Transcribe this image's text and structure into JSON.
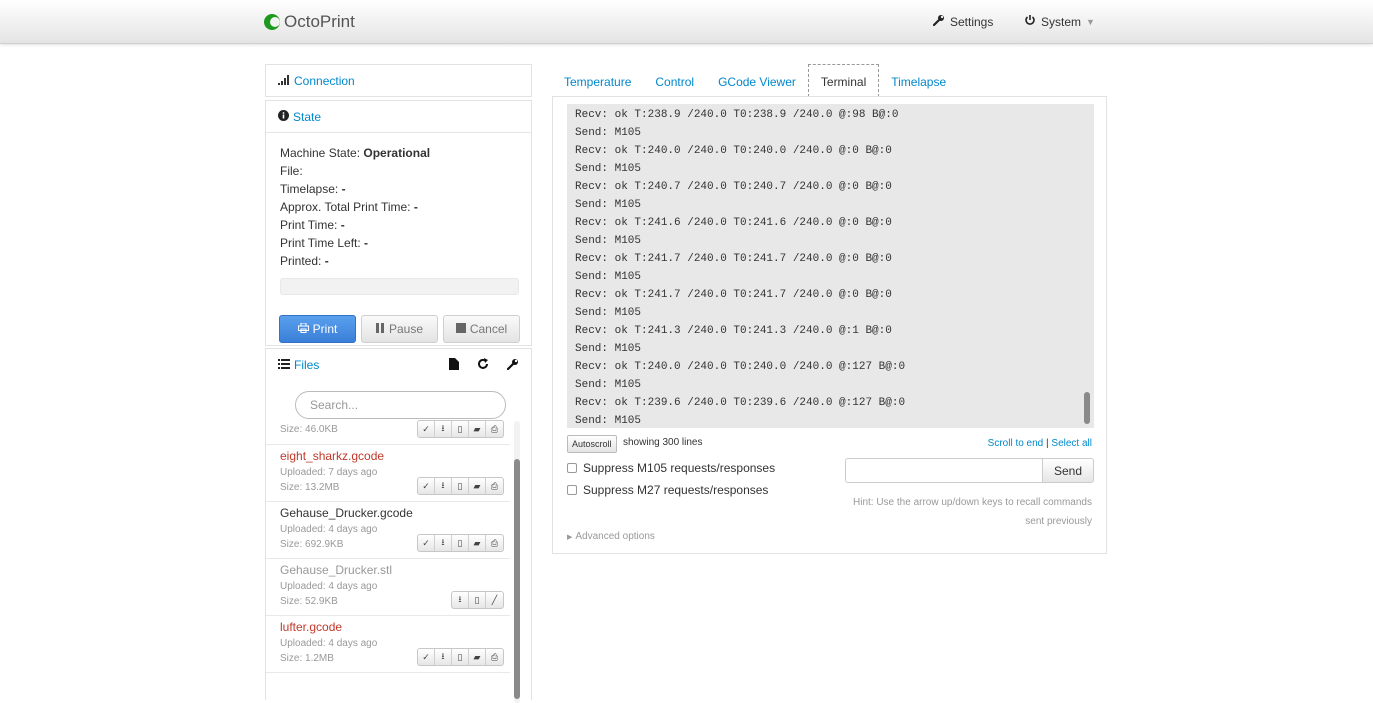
{
  "navbar": {
    "brand": "OctoPrint",
    "settings": "Settings",
    "system": "System"
  },
  "connection": {
    "title": "Connection"
  },
  "state": {
    "title": "State",
    "machine_state_label": "Machine State:",
    "machine_state_value": "Operational",
    "file_label": "File:",
    "timelapse_label": "Timelapse:",
    "timelapse_value": "-",
    "approx_label": "Approx. Total Print Time:",
    "approx_value": "-",
    "print_time_label": "Print Time:",
    "print_time_value": "-",
    "time_left_label": "Print Time Left:",
    "time_left_value": "-",
    "printed_label": "Printed:",
    "printed_value": "-",
    "progress": 0,
    "buttons": {
      "print": "Print",
      "pause": "Pause",
      "cancel": "Cancel"
    }
  },
  "files": {
    "title": "Files",
    "search_placeholder": "Search...",
    "items": [
      {
        "name": "",
        "uploaded": "",
        "size": "Size: 46.0KB",
        "color": "#999999"
      },
      {
        "name": "eight_sharkz.gcode",
        "uploaded": "Uploaded: 7 days ago",
        "size": "Size: 13.2MB",
        "color": "#c0392b"
      },
      {
        "name": "Gehause_Drucker.gcode",
        "uploaded": "Uploaded: 4 days ago",
        "size": "Size: 692.9KB",
        "color": "#333333"
      },
      {
        "name": "Gehause_Drucker.stl",
        "uploaded": "Uploaded: 4 days ago",
        "size": "Size: 52.9KB",
        "color": "#999999"
      },
      {
        "name": "lufter.gcode",
        "uploaded": "Uploaded: 4 days ago",
        "size": "Size: 1.2MB",
        "color": "#c0392b"
      }
    ]
  },
  "tabs": [
    "Temperature",
    "Control",
    "GCode Viewer",
    "Terminal",
    "Timelapse"
  ],
  "active_tab": "Terminal",
  "terminal": {
    "lines": [
      "Recv: ok T:238.9 /240.0 T0:238.9 /240.0 @:98 B@:0",
      "Send: M105",
      "Recv: ok T:240.0 /240.0 T0:240.0 /240.0 @:0 B@:0",
      "Send: M105",
      "Recv: ok T:240.7 /240.0 T0:240.7 /240.0 @:0 B@:0",
      "Send: M105",
      "Recv: ok T:241.6 /240.0 T0:241.6 /240.0 @:0 B@:0",
      "Send: M105",
      "Recv: ok T:241.7 /240.0 T0:241.7 /240.0 @:0 B@:0",
      "Send: M105",
      "Recv: ok T:241.7 /240.0 T0:241.7 /240.0 @:0 B@:0",
      "Send: M105",
      "Recv: ok T:241.3 /240.0 T0:241.3 /240.0 @:1 B@:0",
      "Send: M105",
      "Recv: ok T:240.0 /240.0 T0:240.0 /240.0 @:127 B@:0",
      "Send: M105",
      "Recv: ok T:239.6 /240.0 T0:239.6 /240.0 @:127 B@:0",
      "Send: M105"
    ],
    "autoscroll": "Autoscroll",
    "showing": "showing 300 lines",
    "scroll_to_end": "Scroll to end",
    "select_all": "Select all",
    "suppress_m105": "Suppress M105 requests/responses",
    "suppress_m27": "Suppress M27 requests/responses",
    "send": "Send",
    "hint": "Hint: Use the arrow up/down keys to recall commands sent previously",
    "advanced": "Advanced options"
  }
}
